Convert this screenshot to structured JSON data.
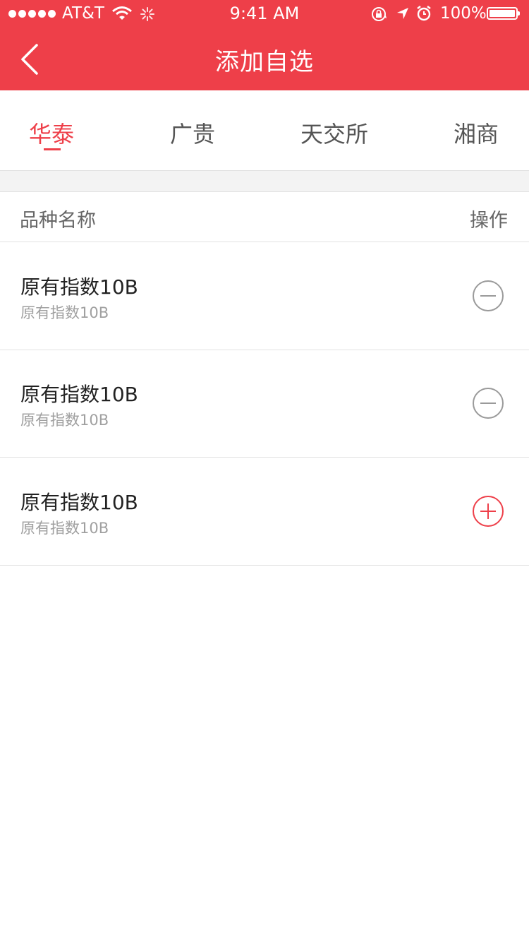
{
  "status_bar": {
    "carrier": "AT&T",
    "time": "9:41 AM",
    "battery": "100%",
    "signal_icon": "signal-dots-icon",
    "wifi_icon": "wifi-icon",
    "activity_icon": "activity-spinner-icon",
    "rotation_lock_icon": "rotation-lock-icon",
    "location_icon": "location-arrow-icon",
    "alarm_icon": "alarm-clock-icon",
    "battery_icon": "battery-icon"
  },
  "nav": {
    "title": "添加自选",
    "back_icon": "chevron-left-icon"
  },
  "tabs": [
    {
      "label": "华泰",
      "active": true
    },
    {
      "label": "广贵",
      "active": false
    },
    {
      "label": "天交所",
      "active": false
    },
    {
      "label": "湘商",
      "active": false
    }
  ],
  "list_header": {
    "name": "品种名称",
    "action": "操作"
  },
  "rows": [
    {
      "title": "原有指数10B",
      "subtitle": "原有指数10B",
      "action": "remove"
    },
    {
      "title": "原有指数10B",
      "subtitle": "原有指数10B",
      "action": "remove"
    },
    {
      "title": "原有指数10B",
      "subtitle": "原有指数10B",
      "action": "add"
    }
  ],
  "colors": {
    "brand": "#ee3f49",
    "remove_icon": "#9a9a9a",
    "add_icon": "#ee3f49"
  }
}
